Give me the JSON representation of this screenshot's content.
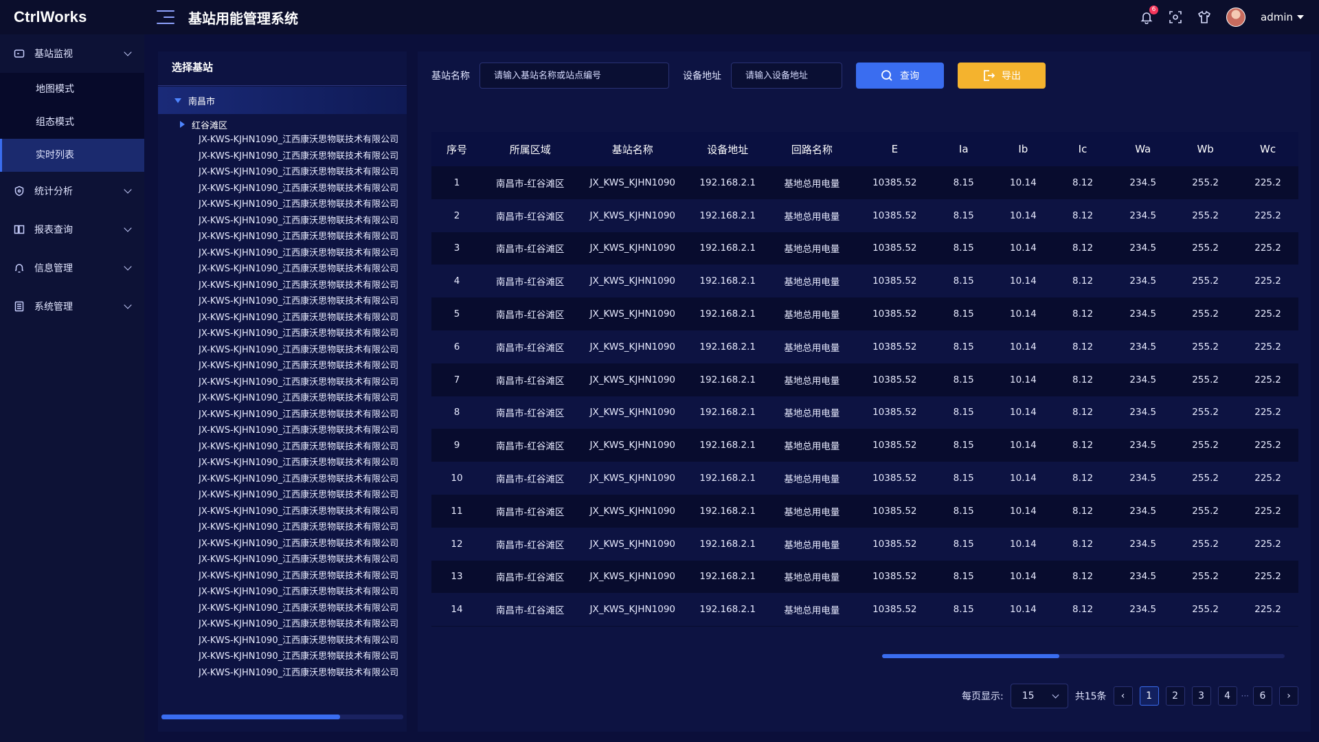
{
  "header": {
    "logo": "CtrlWorks",
    "title": "基站用能管理系统",
    "notification_count": "6",
    "username": "admin"
  },
  "sidebar": {
    "groups": [
      {
        "label": "基站监视",
        "icon": "monitor-icon",
        "expanded": true,
        "items": [
          {
            "label": "地图模式"
          },
          {
            "label": "组态模式"
          },
          {
            "label": "实时列表",
            "active": true
          }
        ]
      },
      {
        "label": "统计分析",
        "icon": "shield-icon"
      },
      {
        "label": "报表查询",
        "icon": "book-icon"
      },
      {
        "label": "信息管理",
        "icon": "bell-icon"
      },
      {
        "label": "系统管理",
        "icon": "list-icon"
      }
    ]
  },
  "tree": {
    "title": "选择基站",
    "root": "南昌市",
    "node": "红谷滩区",
    "leaf_label": "JX-KWS-KJHN1090_江西康沃思物联技术有限公司",
    "leaf_count": 34
  },
  "filters": {
    "station_label": "基站名称",
    "station_placeholder": "请输入基站名称或站点编号",
    "device_label": "设备地址",
    "device_placeholder": "请输入设备地址",
    "query_label": "查询",
    "export_label": "导出"
  },
  "table": {
    "columns": [
      "序号",
      "所属区域",
      "基站名称",
      "设备地址",
      "回路名称",
      "E",
      "Ia",
      "Ib",
      "Ic",
      "Wa",
      "Wb",
      "Wc"
    ],
    "row_template": [
      "南昌市-红谷滩区",
      "JX_KWS_KJHN1090",
      "192.168.2.1",
      "基地总用电量",
      "10385.52",
      "8.15",
      "10.14",
      "8.12",
      "234.5",
      "255.2",
      "225.2"
    ],
    "row_count": 15
  },
  "pagination": {
    "page_size_label": "每页显示:",
    "page_size": "15",
    "total": "共15条",
    "pages": [
      "1",
      "2",
      "3",
      "4",
      "6"
    ],
    "ellipsis": "···",
    "current": "1"
  },
  "colors": {
    "background": "#0b0f3a",
    "accent": "#3a6df0",
    "export": "#f4b32e",
    "badge": "#f5365c"
  }
}
